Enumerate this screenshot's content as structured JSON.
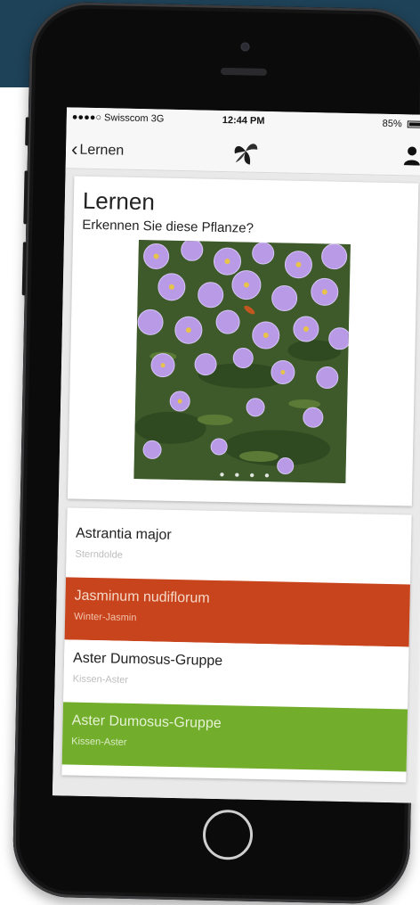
{
  "colors": {
    "background_band": "#1e4258",
    "wrong_answer": "#c7441c",
    "correct_answer": "#72ad2b",
    "muted_text": "#bdbdbd"
  },
  "status_bar": {
    "carrier": "●●●●○ Swisscom  3G",
    "time": "12:44 PM",
    "battery": "85%"
  },
  "nav": {
    "back_label": "Lernen",
    "back_icon": "chevron-left-icon",
    "logo_icon": "leaf-logo-icon",
    "profile_icon": "user-icon"
  },
  "card": {
    "title": "Lernen",
    "question": "Erkennen Sie diese Pflanze?",
    "image_alt": "Purple aster flowers",
    "pager_dots": "● ● ● ●"
  },
  "answers": [
    {
      "scientific": "Astrantia major",
      "common": "Sterndolde",
      "state": "neutral"
    },
    {
      "scientific": "Jasminum nudiflorum",
      "common": "Winter-Jasmin",
      "state": "wrong"
    },
    {
      "scientific": "Aster Dumosus-Gruppe",
      "common": "Kissen-Aster",
      "state": "neutral"
    },
    {
      "scientific": "Aster Dumosus-Gruppe",
      "common": "Kissen-Aster",
      "state": "correct"
    }
  ]
}
